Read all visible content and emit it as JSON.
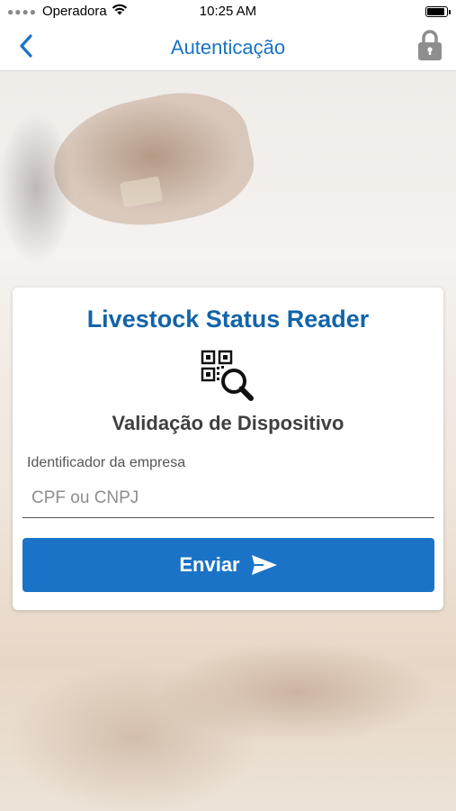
{
  "status_bar": {
    "carrier": "Operadora",
    "time": "10:25 AM",
    "battery_level": 0.9
  },
  "nav": {
    "title": "Autenticação",
    "back_icon": "chevron-left-icon",
    "right_icon": "lock-icon"
  },
  "card": {
    "title": "Livestock Status Reader",
    "icon": "qr-search-icon",
    "subtitle": "Validação de Dispositivo",
    "field_label": "Identificador da empresa",
    "input_placeholder": "CPF ou CNPJ",
    "input_value": "",
    "submit_label": "Enviar",
    "submit_icon": "send-icon"
  },
  "colors": {
    "accent": "#1a73c6",
    "title_blue": "#1264a8",
    "subtitle_gray": "#3f3f3f"
  }
}
